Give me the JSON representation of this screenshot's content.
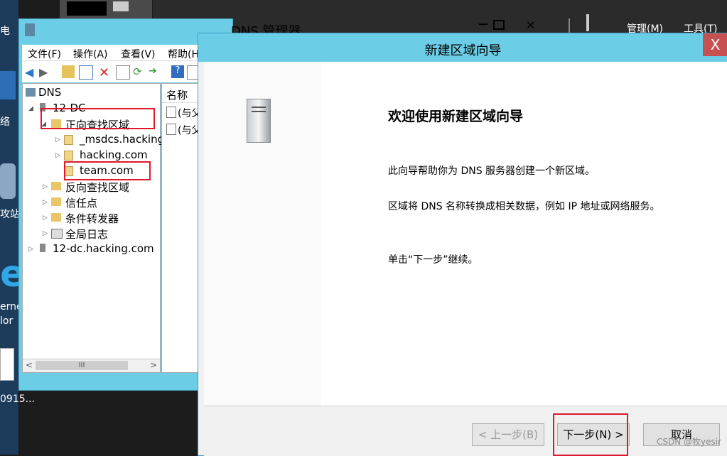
{
  "desktop": {
    "labels": [
      "电",
      "络",
      "攻站",
      "erne",
      "lor",
      "0915..."
    ]
  },
  "server_manager": {
    "menus": [
      "管理(M)",
      "工具(T)"
    ]
  },
  "dns_window": {
    "title": "DNS 管理器",
    "menu": [
      "文件(F)",
      "操作(A)",
      "查看(V)",
      "帮助(H)"
    ],
    "tree": {
      "root": "DNS",
      "server": "12-DC",
      "forward_zone": "正向查找区域",
      "zones": [
        "_msdcs.hacking",
        "hacking.com",
        "team.com"
      ],
      "reverse_zone": "反向查找区域",
      "trust_points": "信任点",
      "conditional_forwarders": "条件转发器",
      "global_logs": "全局日志",
      "server2": "12-dc.hacking.com"
    },
    "list_header": "名称",
    "list_items": [
      "(与父",
      "(与父"
    ],
    "scroll_label": "III"
  },
  "wizard": {
    "title": "新建区域向导",
    "close": "X",
    "heading": "欢迎使用新建区域向导",
    "p1": "此向导帮助你为 DNS 服务器创建一个新区域。",
    "p2": "区域将 DNS 名称转换成相关数据，例如 IP 地址或网络服务。",
    "p3": "单击“下一步”继续。",
    "back": "< 上一步(B)",
    "next": "下一步(N) >",
    "cancel": "取消"
  },
  "watermark": "CSDN @牧yesir"
}
